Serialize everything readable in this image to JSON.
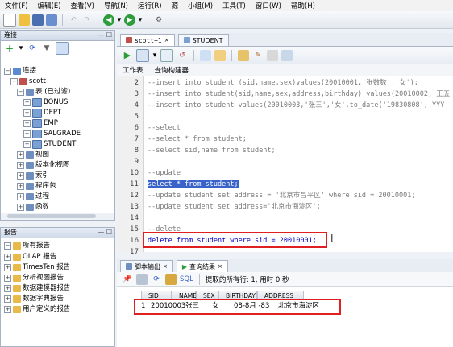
{
  "menubar": [
    "文件(F)",
    "编辑(E)",
    "查看(V)",
    "导航(N)",
    "运行(R)",
    "源",
    "小组(M)",
    "工具(T)",
    "窗口(W)",
    "帮助(H)"
  ],
  "connections": {
    "title": "连接",
    "root": "连接",
    "conn": "scott",
    "tables_node": "表 (已过滤)",
    "tables": [
      "BONUS",
      "DEPT",
      "EMP",
      "SALGRADE",
      "STUDENT"
    ],
    "other_nodes": [
      "视图",
      "版本化视图",
      "索引",
      "程序包",
      "过程",
      "函数"
    ]
  },
  "reports": {
    "title": "报告",
    "items": [
      "所有报告",
      "OLAP 报告",
      "TimesTen 报告",
      "分析视图报告",
      "数据建模器报告",
      "数据字典报告",
      "用户定义的报告"
    ]
  },
  "doc_tabs": [
    "scott~1",
    "STUDENT"
  ],
  "sub_tabs": [
    "工作表",
    "查询构建器"
  ],
  "code_lines": [
    {
      "n": "2",
      "text": "--insert into student (sid,name,sex)values(20010001,'张数数','女');",
      "cls": "cm"
    },
    {
      "n": "3",
      "text": "--insert into student(sid,name,sex,address,birthday) values(20010002,'王五",
      "cls": "cm"
    },
    {
      "n": "4",
      "text": "--insert into student values(20010003,'张三','女',to_date('19830808','YYY",
      "cls": "cm"
    },
    {
      "n": "5",
      "text": "",
      "cls": "cm"
    },
    {
      "n": "6",
      "text": "--select",
      "cls": "cm"
    },
    {
      "n": "7",
      "text": "--select * from student;",
      "cls": "cm"
    },
    {
      "n": "8",
      "text": "--select sid,name from student;",
      "cls": "cm"
    },
    {
      "n": "9",
      "text": "",
      "cls": "cm"
    },
    {
      "n": "10",
      "text": "--update",
      "cls": "cm"
    },
    {
      "n": "11",
      "text": "select * from student;",
      "cls": "hl"
    },
    {
      "n": "12",
      "text": "--update student set address = '北京市昌平区' where sid = 20010001;",
      "cls": "cm"
    },
    {
      "n": "13",
      "text": "--update student set address='北京市海淀区';",
      "cls": "cm"
    },
    {
      "n": "14",
      "text": "",
      "cls": "cm"
    },
    {
      "n": "15",
      "text": "--delete",
      "cls": "cm"
    },
    {
      "n": "16",
      "text": "delete from student where sid = 20010001;",
      "cls": "kw"
    },
    {
      "n": "17",
      "text": "",
      "cls": "cm"
    }
  ],
  "output_tabs": [
    "脚本输出",
    "查询结果"
  ],
  "output_toolbar": {
    "sql": "SQL",
    "status": "提取的所有行: 1, 用时 0 秒"
  },
  "grid": {
    "headers": [
      "SID",
      "NAME",
      "SEX",
      "BIRTHDAY",
      "ADDRESS"
    ],
    "rows": [
      {
        "num": "1",
        "cells": [
          "20010003",
          "张三",
          "女",
          "08-8月 -83",
          "北京市海淀区"
        ]
      }
    ]
  },
  "accent_colors": {
    "selection": "#3a63c9",
    "highlight_box": "#e02020"
  }
}
